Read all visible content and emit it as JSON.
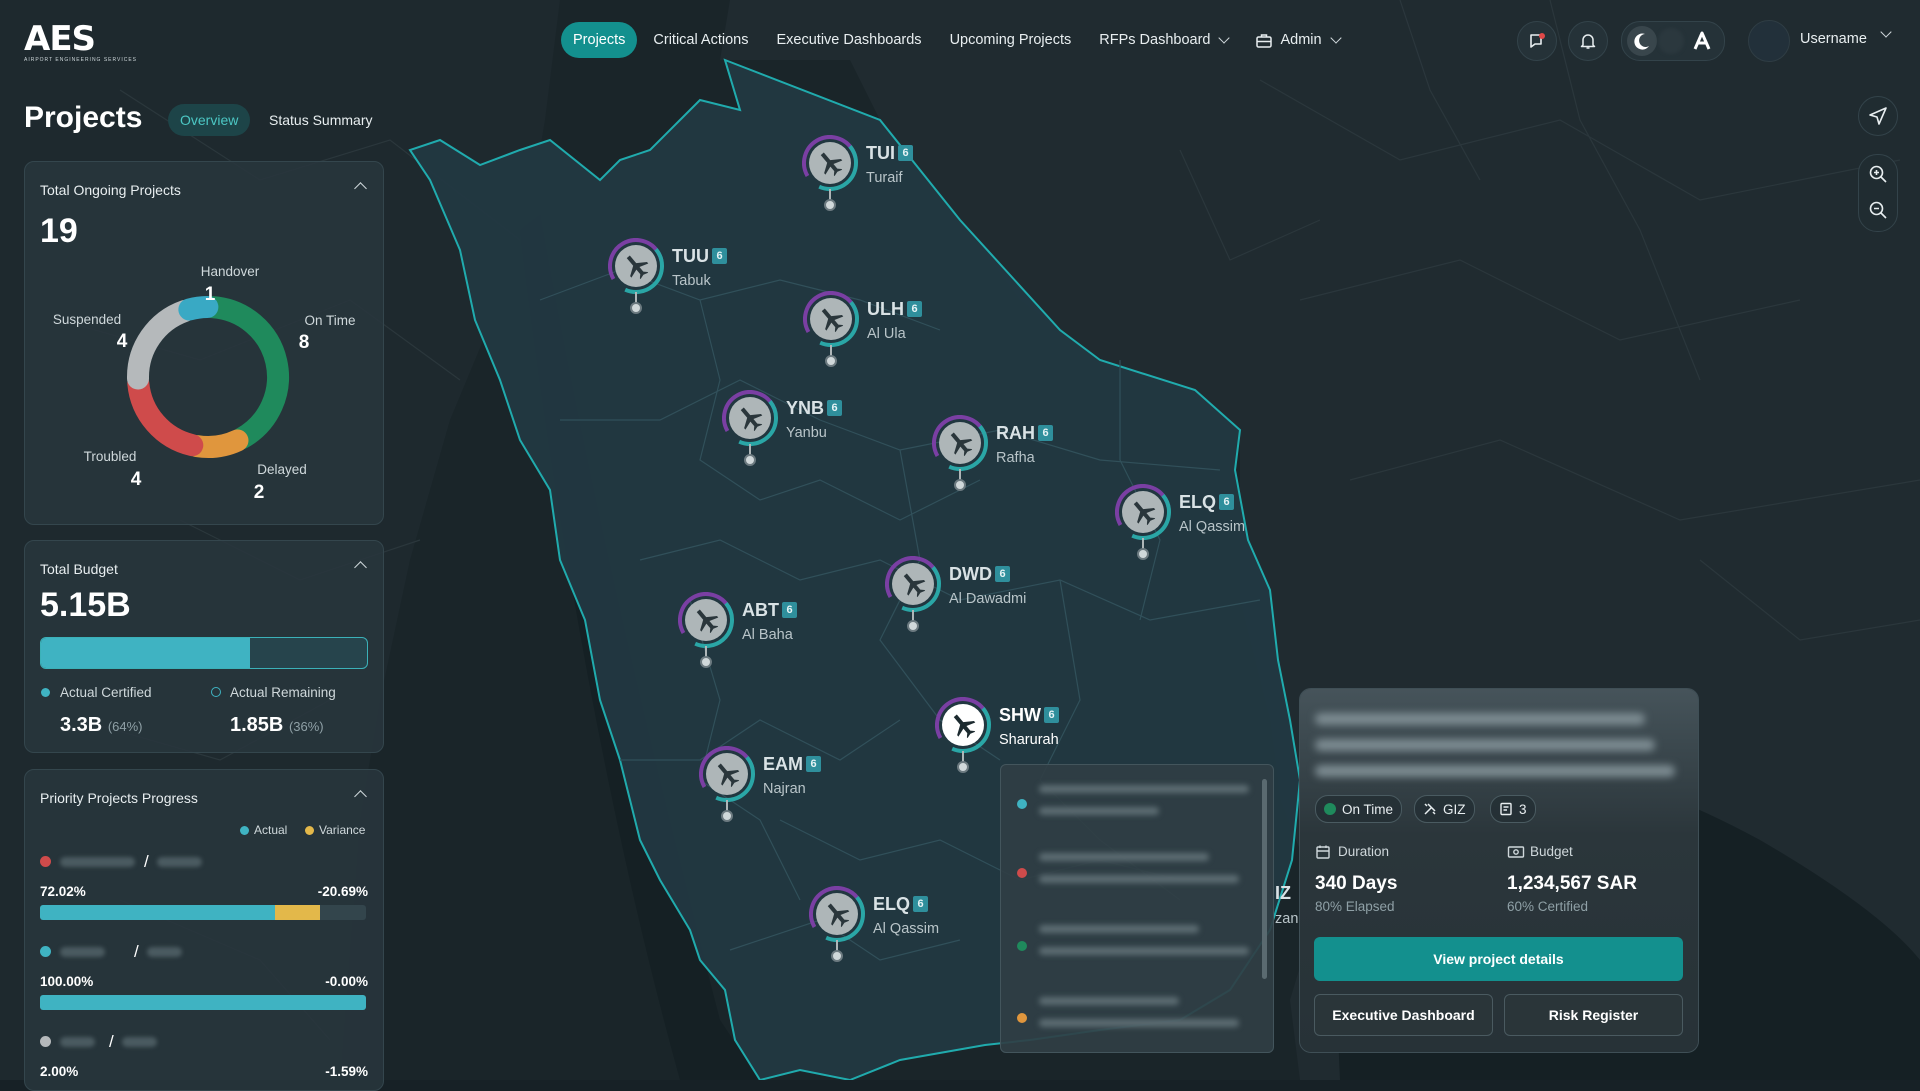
{
  "app": {
    "logo": "AES",
    "logo_sub": "AIRPORT ENGINEERING SERVICES"
  },
  "nav": {
    "items": [
      {
        "label": "Projects",
        "active": true
      },
      {
        "label": "Critical Actions"
      },
      {
        "label": "Executive Dashboards"
      },
      {
        "label": "Upcoming Projects"
      },
      {
        "label": "RFPs Dashboard",
        "dropdown": true
      },
      {
        "label": "Admin",
        "dropdown": true,
        "icon": "briefcase-icon"
      }
    ],
    "username": "Username"
  },
  "page": {
    "title": "Projects",
    "tabs": [
      {
        "label": "Overview",
        "active": true
      },
      {
        "label": "Status Summary"
      }
    ]
  },
  "ongoing": {
    "title": "Total Ongoing Projects",
    "total": "19",
    "segments": [
      {
        "label": "On Time",
        "value": "8",
        "color": "#1f8a5c"
      },
      {
        "label": "Delayed",
        "value": "2",
        "color": "#e0963d"
      },
      {
        "label": "Troubled",
        "value": "4",
        "color": "#cf4b4b"
      },
      {
        "label": "Suspended",
        "value": "4",
        "color": "#b5b9bb"
      },
      {
        "label": "Handover",
        "value": "1",
        "color": "#39a9c4"
      }
    ]
  },
  "budget": {
    "title": "Total Budget",
    "total": "5.15B",
    "certified_fraction": 0.64,
    "certified": {
      "label": "Actual Certified",
      "value": "3.3B",
      "pct": "(64%)",
      "color": "#3fb3c2"
    },
    "remaining": {
      "label": "Actual Remaining",
      "value": "1.85B",
      "pct": "(36%)",
      "color": "#3fb3c2"
    }
  },
  "priority": {
    "title": "Priority Projects Progress",
    "legend": [
      {
        "label": "Actual",
        "color": "#3fb3c2"
      },
      {
        "label": "Variance",
        "color": "#e3b84a"
      }
    ],
    "rows": [
      {
        "dot": "#cf4b4b",
        "slash": "/",
        "actual_label": "72.02%",
        "variance_label": "-20.69%",
        "actual": 0.72,
        "variance": 0.14
      },
      {
        "dot": "#3fb3c2",
        "slash": "/",
        "actual_label": "100.00%",
        "variance_label": "-0.00%",
        "actual": 1.0,
        "variance": 0
      },
      {
        "dot": "#b5b9bb",
        "slash": "/",
        "actual_label": "2.00%",
        "variance_label": "-1.59%",
        "actual": 0.02,
        "variance": 0.016
      }
    ]
  },
  "markers": [
    {
      "code": "TUI",
      "count": "6",
      "city": "Turaif"
    },
    {
      "code": "TUU",
      "count": "6",
      "city": "Tabuk"
    },
    {
      "code": "ULH",
      "count": "6",
      "city": "Al Ula"
    },
    {
      "code": "YNB",
      "count": "6",
      "city": "Yanbu"
    },
    {
      "code": "RAH",
      "count": "6",
      "city": "Rafha"
    },
    {
      "code": "ELQ",
      "count": "6",
      "city": "Al Qassim"
    },
    {
      "code": "DWD",
      "count": "6",
      "city": "Al Dawadmi"
    },
    {
      "code": "ABT",
      "count": "6",
      "city": "Al Baha"
    },
    {
      "code": "SHW",
      "count": "6",
      "city": "Sharurah",
      "selected": true
    },
    {
      "code": "EAM",
      "count": "6",
      "city": "Najran"
    },
    {
      "code": "ELQ",
      "count": "6",
      "city": "Al Qassim"
    }
  ],
  "partial_marker": {
    "code": "IZ",
    "city": "zan"
  },
  "list_popup": {
    "dots": [
      "#3fb3c2",
      "#cf4b4b",
      "#1f8a5c",
      "#e0963d"
    ]
  },
  "detail": {
    "status": "On Time",
    "status_color": "#1f8a5c",
    "partner": "GIZ",
    "doc_count": "3",
    "duration_label": "Duration",
    "duration_value": "340 Days",
    "duration_sub": "80% Elapsed",
    "budget_label": "Budget",
    "budget_value": "1,234,567 SAR",
    "budget_sub": "60% Certified",
    "primary_button": "View project details",
    "secondary_left": "Executive Dashboard",
    "secondary_right": "Risk Register"
  }
}
